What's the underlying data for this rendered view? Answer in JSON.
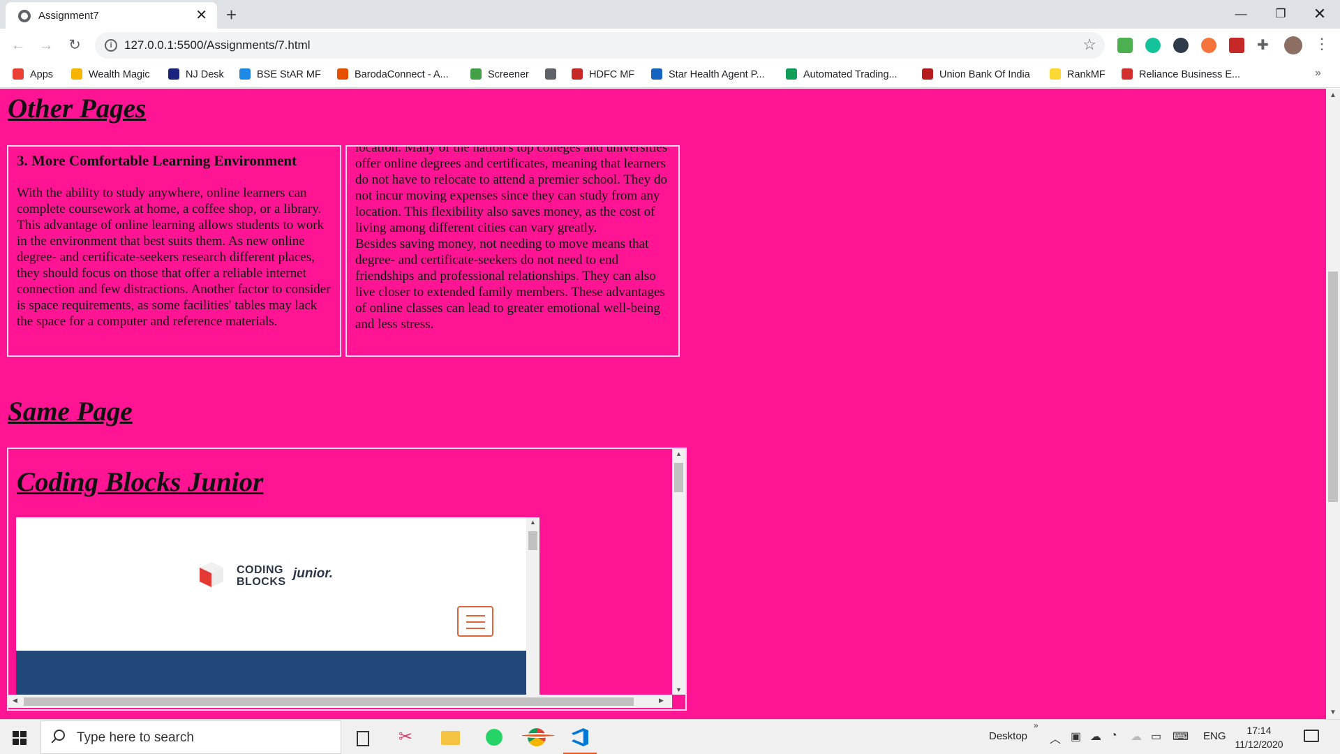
{
  "browser": {
    "tab_title": "Assignment7",
    "tab_close": "✕",
    "new_tab": "+",
    "url": "127.0.0.1:5500/Assignments/7.html",
    "bookmarks": [
      {
        "label": "Apps",
        "color": "#e94235"
      },
      {
        "label": "Wealth Magic",
        "color": "#f4b400"
      },
      {
        "label": "NJ Desk",
        "color": "#1a237e"
      },
      {
        "label": "BSE StAR MF",
        "color": "#1e88e5"
      },
      {
        "label": "BarodaConnect - A...",
        "color": "#e65100"
      },
      {
        "label": "Screener",
        "color": "#43a047"
      },
      {
        "label": "",
        "color": "#5f6368"
      },
      {
        "label": "HDFC MF",
        "color": "#c62828"
      },
      {
        "label": "Star Health Agent P...",
        "color": "#1565c0"
      },
      {
        "label": "Automated Trading...",
        "color": "#0f9d58"
      },
      {
        "label": "Union Bank Of India",
        "color": "#b71c1c"
      },
      {
        "label": "RankMF",
        "color": "#fdd835"
      },
      {
        "label": "Reliance Business E...",
        "color": "#d32f2f"
      }
    ],
    "bookmarks_more": "»"
  },
  "page": {
    "background": "#ff1493",
    "heading_other": "Other Pages",
    "heading_same": "Same Page",
    "left_box": {
      "heading": "3. More Comfortable Learning Environment",
      "paragraph": "With the ability to study anywhere, online learners can complete coursework at home, a coffee shop, or a library. This advantage of online learning allows students to work in the environment that best suits them. As new online degree- and certificate-seekers research different places, they should focus on those that offer a reliable internet connection and few distractions. Another factor to consider is space requirements, as some facilities' tables may lack the space for a computer and reference materials."
    },
    "right_box": {
      "paragraph_1": "location. Many of the nation's top colleges and universities offer online degrees and certificates, meaning that learners do not have to relocate to attend a premier school. They do not incur moving expenses since they can study from any location. This flexibility also saves money, as the cost of living among different cities can vary greatly.",
      "paragraph_2": "Besides saving money, not needing to move means that degree- and certificate-seekers do not need to end friendships and professional relationships. They can also live closer to extended family members. These advantages of online classes can lead to greater emotional well-being and less stress."
    },
    "iframe": {
      "heading": "Coding Blocks Junior",
      "logo_line1": "CODING",
      "logo_line2": "BLOCKS",
      "logo_junior": "junior.",
      "banner_color": "#224879",
      "accent_color": "#e0643a"
    }
  },
  "taskbar": {
    "search_placeholder": "Type here to search",
    "desktop_label": "Desktop",
    "chevrons": "»",
    "language": "ENG",
    "time": "17:14",
    "date": "11/12/2020"
  }
}
